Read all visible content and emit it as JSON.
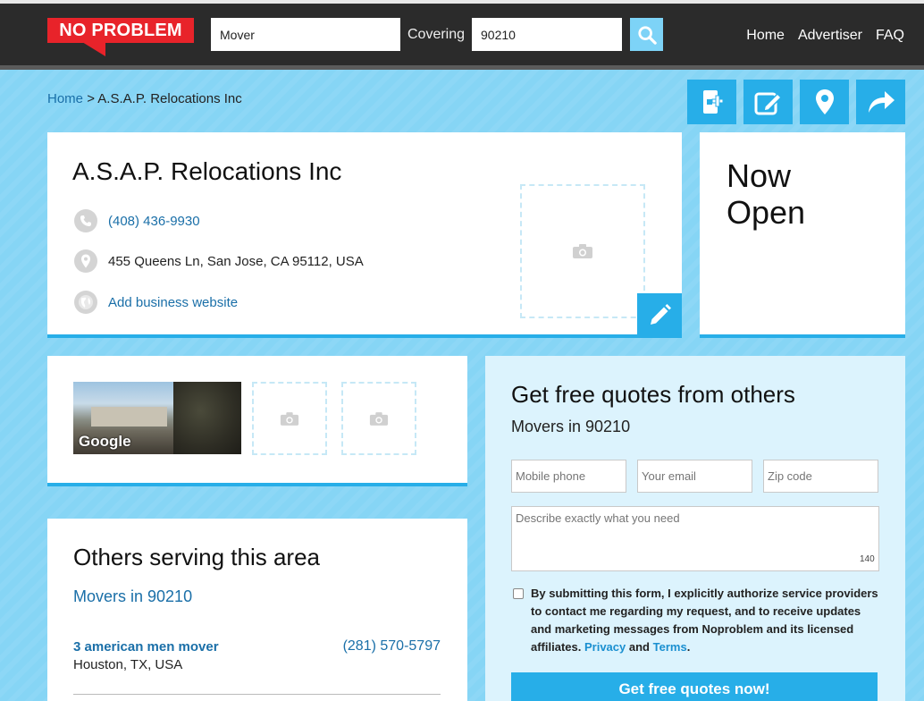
{
  "header": {
    "logo": "NO PROBLEM",
    "search_what": "Mover",
    "covering_label": "Covering",
    "search_where": "90210",
    "nav": [
      "Home",
      "Advertiser",
      "FAQ"
    ]
  },
  "breadcrumb": {
    "home": "Home",
    "separator": ">",
    "current": "A.S.A.P. Relocations Inc"
  },
  "actions": [
    "add-to-phone-icon",
    "edit-review-icon",
    "map-pin-icon",
    "share-icon"
  ],
  "business": {
    "name": "A.S.A.P. Relocations Inc",
    "phone": "(408) 436-9930",
    "address": "455 Queens Ln, San Jose, CA 95112, USA",
    "website_link": "Add business website",
    "status": "Now Open"
  },
  "photos": {
    "streetview_label": "Google"
  },
  "others": {
    "title": "Others serving this area",
    "subtitle": "Movers in 90210",
    "providers": [
      {
        "name": "3 american men mover",
        "phone": "(281) 570-5797",
        "location": "Houston, TX, USA"
      }
    ]
  },
  "quote": {
    "title": "Get free quotes from others",
    "subtitle": "Movers in 90210",
    "phone_placeholder": "Mobile phone",
    "email_placeholder": "Your email",
    "zip_placeholder": "Zip code",
    "desc_placeholder": "Describe exactly what you need",
    "char_count": "140",
    "consent_main": "By submitting this form, I explicitly authorize service providers to contact me regarding my request, and to receive updates and marketing messages from Noproblem and its licensed affiliates.",
    "privacy": "Privacy",
    "and": "and",
    "terms": "Terms",
    "period": ".",
    "submit": "Get free quotes now!"
  },
  "colors": {
    "accent": "#27aee8",
    "brand": "#e8232a",
    "header_bg": "#2b2b2b",
    "page_bg": "#86d5f5",
    "link": "#1a6fa8"
  }
}
